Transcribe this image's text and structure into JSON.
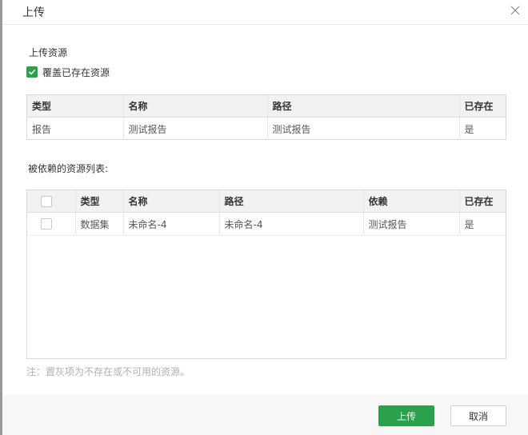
{
  "dialog": {
    "title": "上传",
    "close_icon": "close-icon"
  },
  "upload_resources": {
    "label": "上传资源",
    "overwrite": {
      "label": "覆盖已存在资源",
      "checked": true
    },
    "columns": [
      "类型",
      "名称",
      "路径",
      "已存在"
    ],
    "rows": [
      {
        "type": "报告",
        "name": "测试报告",
        "path": "测试报告",
        "exists": "是"
      }
    ]
  },
  "dependent_resources": {
    "label": "被依赖的资源列表:",
    "columns": [
      "类型",
      "名称",
      "路径",
      "依赖",
      "已存在"
    ],
    "rows": [
      {
        "checked": false,
        "type": "数据集",
        "name": "未命名-4",
        "path": "未命名-4",
        "dependency": "测试报告",
        "exists": "是"
      }
    ]
  },
  "note": "注：置灰项为不存在或不可用的资源。",
  "buttons": {
    "upload": "上传",
    "cancel": "取消"
  },
  "colors": {
    "primary": "#2aa14a",
    "exists_yes": "#c0392b"
  }
}
